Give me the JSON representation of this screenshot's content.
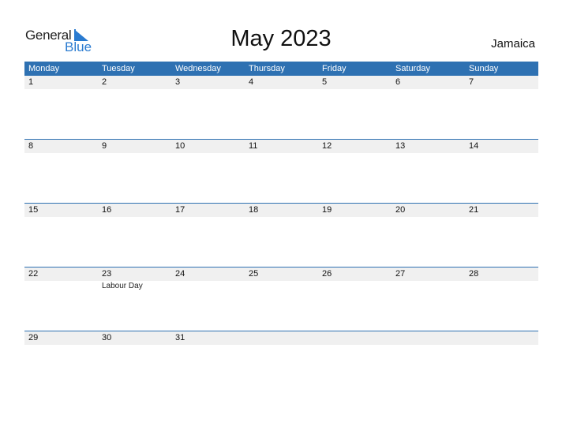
{
  "logo": {
    "line1": "General",
    "line2": "Blue"
  },
  "title": "May 2023",
  "country": "Jamaica",
  "colors": {
    "header_bg": "#2e71b2",
    "accent": "#2a7bd0",
    "date_band": "#f0f0f0"
  },
  "weekdays": [
    "Monday",
    "Tuesday",
    "Wednesday",
    "Thursday",
    "Friday",
    "Saturday",
    "Sunday"
  ],
  "weeks": [
    {
      "days": [
        "1",
        "2",
        "3",
        "4",
        "5",
        "6",
        "7"
      ],
      "events": [
        "",
        "",
        "",
        "",
        "",
        "",
        ""
      ]
    },
    {
      "days": [
        "8",
        "9",
        "10",
        "11",
        "12",
        "13",
        "14"
      ],
      "events": [
        "",
        "",
        "",
        "",
        "",
        "",
        ""
      ]
    },
    {
      "days": [
        "15",
        "16",
        "17",
        "18",
        "19",
        "20",
        "21"
      ],
      "events": [
        "",
        "",
        "",
        "",
        "",
        "",
        ""
      ]
    },
    {
      "days": [
        "22",
        "23",
        "24",
        "25",
        "26",
        "27",
        "28"
      ],
      "events": [
        "",
        "Labour Day",
        "",
        "",
        "",
        "",
        ""
      ]
    },
    {
      "days": [
        "29",
        "30",
        "31",
        "",
        "",
        "",
        ""
      ],
      "events": [
        "",
        "",
        "",
        "",
        "",
        "",
        ""
      ]
    }
  ]
}
